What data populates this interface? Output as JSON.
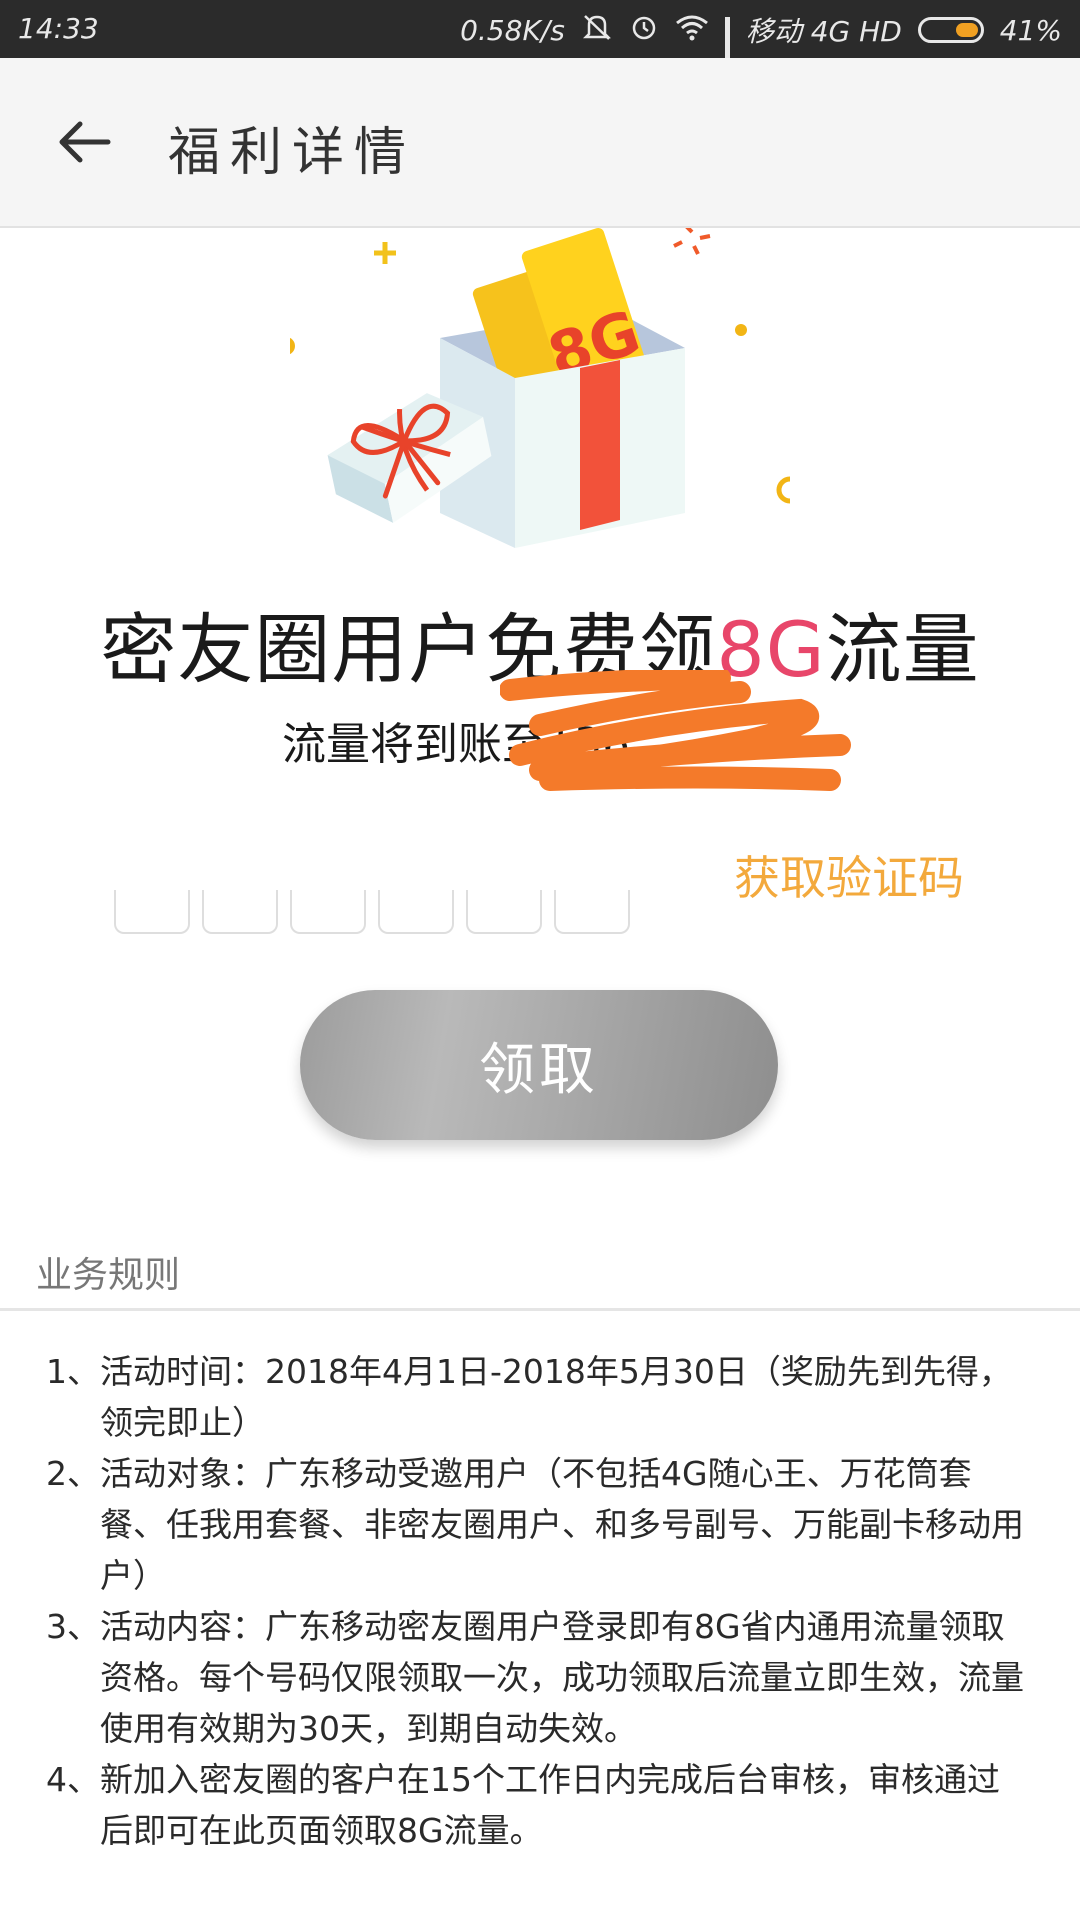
{
  "status_bar": {
    "time": "14:33",
    "speed": "0.58K/s",
    "carrier": "移动 4G HD",
    "battery": "41%"
  },
  "app_bar": {
    "title": "福利详情"
  },
  "hero": {
    "ticket_label": "8G"
  },
  "headline": {
    "prefix": "密友圈用户免费领",
    "accent": "8G",
    "suffix": "流量",
    "accent_color": "#e8466a"
  },
  "subline": {
    "text": "流量将到账至136"
  },
  "verify": {
    "get_code_label": "获取验证码",
    "code_length": 6
  },
  "claim_button": {
    "label": "领取"
  },
  "rules": {
    "header": "业务规则",
    "items": [
      {
        "num": "1、",
        "text": "活动时间：2018年4月1日-2018年5月30日（奖励先到先得，领完即止）"
      },
      {
        "num": "2、",
        "text": "活动对象：广东移动受邀用户（不包括4G随心王、万花筒套餐、任我用套餐、非密友圈用户、和多号副号、万能副卡移动用户）"
      },
      {
        "num": "3、",
        "text": "活动内容：广东移动密友圈用户登录即有8G省内通用流量领取资格。每个号码仅限领取一次，成功领取后流量立即生效，流量使用有效期为30天，到期自动失效。"
      },
      {
        "num": "4、",
        "text": "新加入密友圈的客户在15个工作日内完成后台审核，审核通过后即可在此页面领取8G流量。"
      }
    ]
  },
  "colors": {
    "accent_orange": "#f3a93c",
    "scribble": "#f47a2a"
  }
}
